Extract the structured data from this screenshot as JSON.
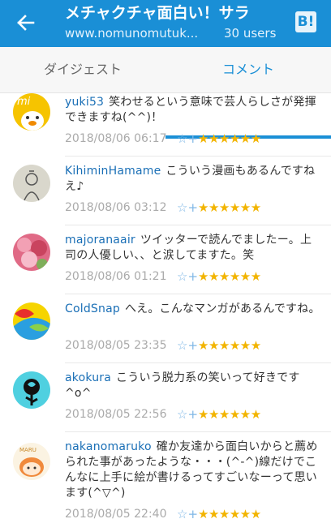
{
  "header": {
    "title": "メチャクチャ面白い！サラ",
    "domain": "www.nomunomutuk...",
    "users": "30 users",
    "hatena_button": "B!",
    "colors": {
      "bar": "#1a8fd6"
    }
  },
  "tabs": [
    {
      "label": "ダイジェスト",
      "active": false
    },
    {
      "label": "コメント",
      "active": true
    }
  ],
  "comments": [
    {
      "user": "yuki53",
      "text": "笑わせるという意味で芸人らしさが発揮できますね(^^)！",
      "date": "2018/08/06 06:17",
      "stars": "★★★★★★",
      "avatar": "duck-avatar"
    },
    {
      "user": "KihiminHamame",
      "text": "こういう漫画もあるんですねえ♪",
      "date": "2018/08/06 03:12",
      "stars": "★★★★★★",
      "avatar": "sketch-avatar"
    },
    {
      "user": "majoranaair",
      "text": "ツイッターで読んでましたー。上司の人優しい、、と涙してますた。笑",
      "date": "2018/08/06 01:21",
      "stars": "★★★★★★",
      "avatar": "flower-avatar"
    },
    {
      "user": "ColdSnap",
      "text": "へえ。こんなマンガがあるんですね。",
      "date": "2018/08/05 23:35",
      "stars": "★★★★★★",
      "avatar": "colorful-avatar"
    },
    {
      "user": "akokura",
      "text": "こういう脱力系の笑いって好きです^o^",
      "date": "2018/08/05 22:56",
      "stars": "★★★★★★",
      "avatar": "rose-avatar"
    },
    {
      "user": "nakanomaruko",
      "text": "確か友達から面白いからと薦められた事があったような・・・(^-^)線だけでこんなに上手に絵が書けるってすごいなーって思います(^▽^)",
      "date": "2018/08/05 22:40",
      "stars": "★★★★★★",
      "avatar": "character-avatar"
    }
  ],
  "add_star_icon": "☆+"
}
